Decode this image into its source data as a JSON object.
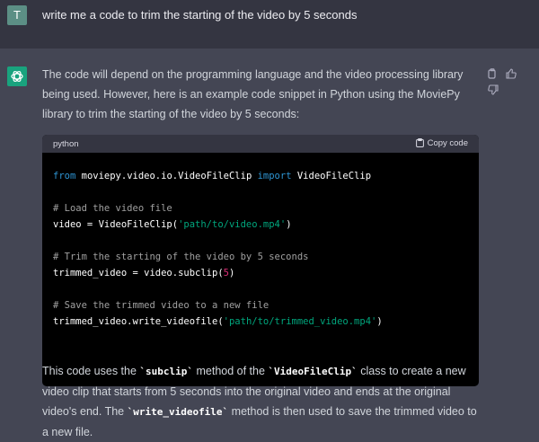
{
  "user": {
    "avatar_letter": "T",
    "message": "write me a code to trim the starting of the video by 5 seconds"
  },
  "assistant": {
    "intro": "The code will depend on the programming language and the video processing library being used. However, here is an example code snippet in Python using the MoviePy library to trim the starting of the video by 5 seconds:",
    "code_language": "python",
    "copy_label": "Copy code",
    "code": {
      "l1_kw1": "from",
      "l1_mod": " moviepy.video.io.VideoFileClip ",
      "l1_kw2": "import",
      "l1_rest": " VideoFileClip",
      "c1": "# Load the video file",
      "l2_a": "video = VideoFileClip(",
      "l2_str": "'path/to/video.mp4'",
      "l2_b": ")",
      "c2": "# Trim the starting of the video by 5 seconds",
      "l3_a": "trimmed_video = video.subclip(",
      "l3_num": "5",
      "l3_b": ")",
      "c3": "# Save the trimmed video to a new file",
      "l4_a": "trimmed_video.write_videofile(",
      "l4_str": "'path/to/trimmed_video.mp4'",
      "l4_b": ")"
    },
    "outro": {
      "t1": "This code uses the ",
      "c1": "`subclip`",
      "t2": " method of the ",
      "c2": "`VideoFileClip`",
      "t3": " class to create a new video clip that starts from 5 seconds into the original video and ends at the original video's end. The ",
      "c3": "`write_videofile`",
      "t4": " method is then used to save the trimmed video to a new file."
    }
  },
  "colors": {
    "user_bg": "#343541",
    "assistant_bg": "#444654",
    "assistant_avatar": "#19a37e",
    "user_avatar": "#5c8f85"
  }
}
